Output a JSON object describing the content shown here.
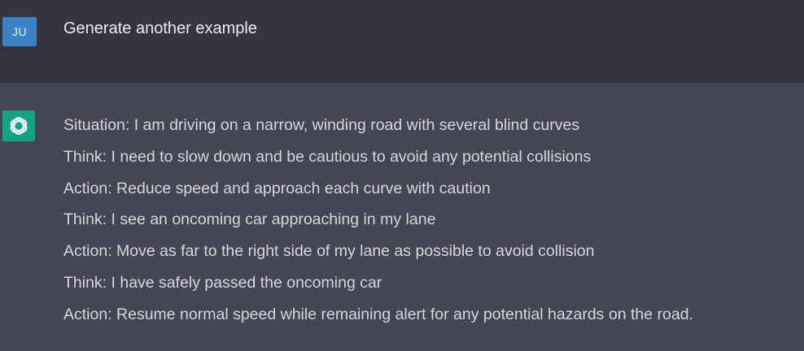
{
  "colors": {
    "user_row_bg": "#343541",
    "assistant_row_bg": "#444654",
    "user_avatar_bg": "#3c82c7",
    "assistant_avatar_bg": "#12a383"
  },
  "user_message": {
    "avatar_initials": "JU",
    "text": "Generate another example"
  },
  "assistant_message": {
    "avatar_icon": "openai-logo-icon",
    "lines": [
      "Situation: I am driving on a narrow, winding road with several blind curves",
      "Think: I need to slow down and be cautious to avoid any potential collisions",
      "Action: Reduce speed and approach each curve with caution",
      "Think: I see an oncoming car approaching in my lane",
      "Action: Move as far to the right side of my lane as possible to avoid collision",
      "Think: I have safely passed the oncoming car",
      "Action: Resume normal speed while remaining alert for any potential hazards on the road."
    ]
  }
}
